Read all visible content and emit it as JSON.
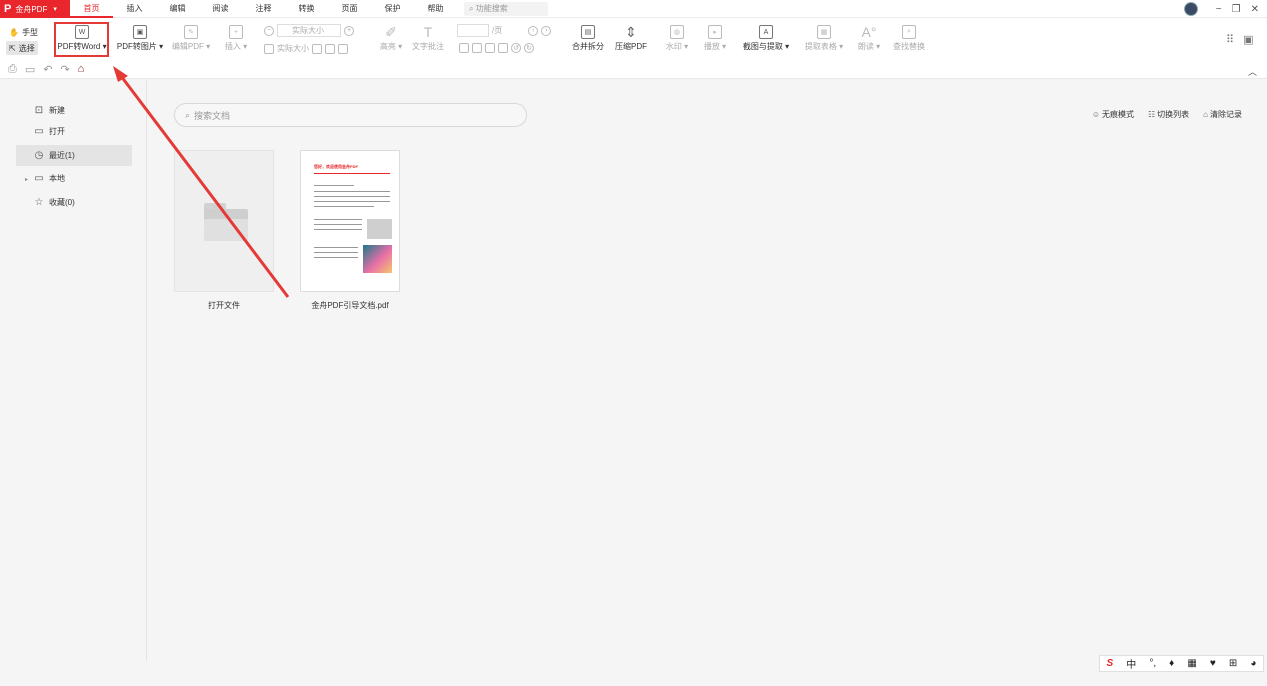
{
  "app": {
    "name": "金舟PDF",
    "menu_tabs": [
      "首页",
      "插入",
      "编辑",
      "阅读",
      "注释",
      "转换",
      "页面",
      "保护",
      "帮助"
    ],
    "active_tab": "首页",
    "search_placeholder": "功能搜索"
  },
  "ribbon": {
    "hand_label": "手型",
    "select_label": "选择",
    "pdf_to_word": "PDF转Word",
    "pdf_to_image": "PDF转图片",
    "edit_pdf": "编辑PDF",
    "insert": "插入",
    "zoom_placeholder": "实际大小",
    "actual_size": "实际大小",
    "highlight": "高亮",
    "text_comment": "文字批注",
    "page_unit": "/页",
    "merge_split": "合并拆分",
    "compress": "压缩PDF",
    "watermark": "水印",
    "play": "播放",
    "screenshot_extract": "截图与提取",
    "extract_table": "提取表格",
    "read_aloud": "朗读",
    "find_replace": "查找替换"
  },
  "sidebar": {
    "items": [
      {
        "label": "新建",
        "icon": "new-file-icon"
      },
      {
        "label": "打开",
        "icon": "open-icon"
      },
      {
        "label": "最近(1)",
        "icon": "clock-icon"
      },
      {
        "label": "本地",
        "icon": "computer-icon"
      },
      {
        "label": "收藏(0)",
        "icon": "star-icon"
      }
    ]
  },
  "main": {
    "search_placeholder": "搜索文档",
    "actions": [
      "无痕模式",
      "切换列表",
      "清除记录"
    ],
    "open_file_label": "打开文件",
    "doc_name": "金舟PDF引导文档.pdf",
    "doc_preview_title": "您好，欢迎使用金舟PDF"
  },
  "ime": {
    "mode": "中"
  },
  "colors": {
    "brand": "#e8262c",
    "annotation": "#e53935"
  }
}
